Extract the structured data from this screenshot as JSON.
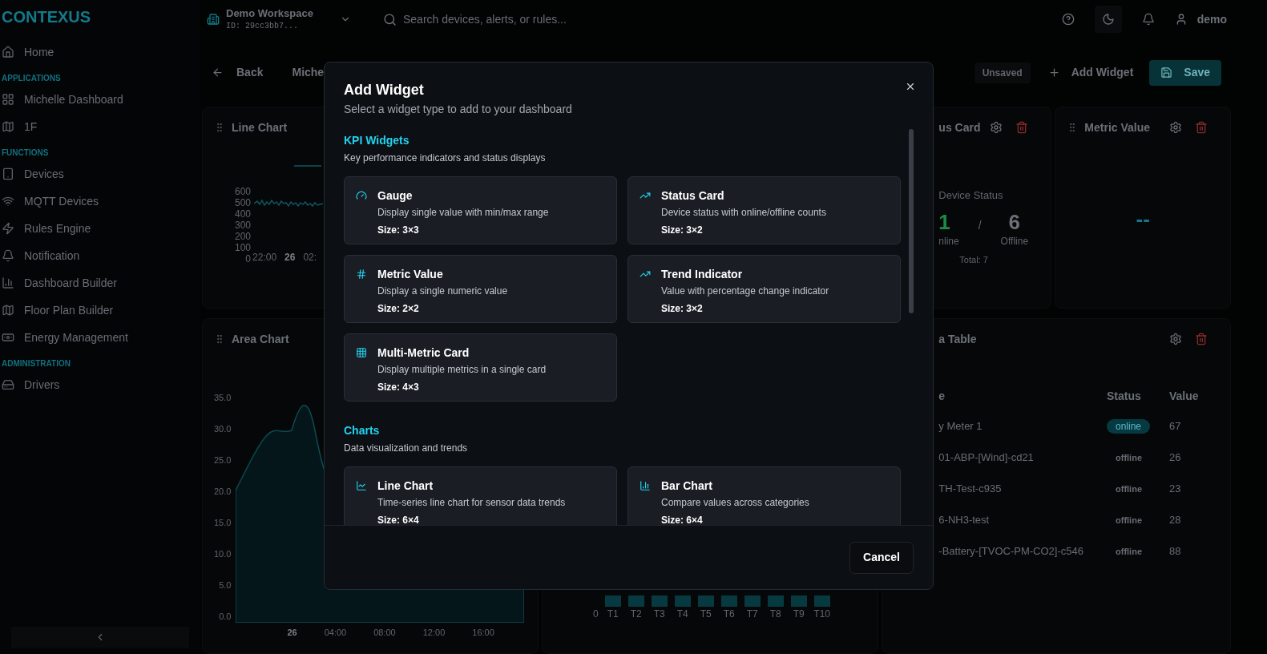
{
  "sidebar": {
    "logo": "CONTEXUS",
    "sections": [
      {
        "items": [
          {
            "label": "Home"
          }
        ]
      },
      {
        "title": "APPLICATIONS",
        "items": [
          {
            "label": "Michelle Dashboard"
          },
          {
            "label": "1F"
          }
        ]
      },
      {
        "title": "FUNCTIONS",
        "items": [
          {
            "label": "Devices"
          },
          {
            "label": "MQTT Devices"
          },
          {
            "label": "Rules Engine"
          },
          {
            "label": "Notification"
          },
          {
            "label": "Dashboard Builder"
          },
          {
            "label": "Floor Plan Builder"
          },
          {
            "label": "Energy Management"
          }
        ]
      },
      {
        "title": "ADMINISTRATION",
        "items": [
          {
            "label": "Drivers"
          }
        ]
      }
    ]
  },
  "header": {
    "workspace": {
      "name": "Demo Workspace",
      "id": "ID: 29cc3bb7..."
    },
    "search": {
      "placeholder": "Search devices, alerts, or rules..."
    },
    "user": "demo"
  },
  "toolbar": {
    "back": "Back",
    "dashboard_name": "Miche",
    "status_badge": "Unsaved",
    "add_widget": "Add Widget",
    "save": "Save"
  },
  "widgets": {
    "line_chart": {
      "title": "Line Chart",
      "y_ticks": [
        "600",
        "500",
        "400",
        "300",
        "200",
        "100",
        "0"
      ],
      "x_ticks": [
        {
          "label": "22:00",
          "major": false
        },
        {
          "label": "26",
          "major": true
        },
        {
          "label": "02:",
          "major": false
        }
      ]
    },
    "area_chart": {
      "title": "Area Chart",
      "y_ticks": [
        "35.0",
        "30.0",
        "25.0",
        "20.0",
        "15.0",
        "10.0",
        "5.0",
        "0.0"
      ],
      "x_ticks": [
        {
          "label": "26",
          "major": true
        },
        {
          "label": "04:00",
          "major": false
        },
        {
          "label": "08:00",
          "major": false
        },
        {
          "label": "12:00",
          "major": false
        },
        {
          "label": "16:00",
          "major": false
        }
      ]
    },
    "bar_chart": {
      "y_tick": "0",
      "categories": [
        "T1",
        "T2",
        "T3",
        "T4",
        "T5",
        "T6",
        "T7",
        "T8",
        "T9",
        "T10"
      ]
    },
    "status_card": {
      "title": "us Card",
      "label": "Device Status",
      "online_count": "1",
      "separator": "/",
      "offline_count": "6",
      "online_label": "nline",
      "offline_label": "Offline",
      "total": "Total: 7"
    },
    "metric_value": {
      "title": "Metric Value",
      "value": "--"
    },
    "data_table": {
      "title": "a Table",
      "columns": [
        "e",
        "Status",
        "Value"
      ],
      "rows": [
        {
          "name": "y Meter 1",
          "status": "online",
          "kind": "online",
          "value": "67"
        },
        {
          "name": "01-ABP-[Wind]-cd21",
          "status": "offline",
          "kind": "offline",
          "value": "26"
        },
        {
          "name": "TH-Test-c935",
          "status": "offline",
          "kind": "offline",
          "value": "23"
        },
        {
          "name": "6-NH3-test",
          "status": "offline",
          "kind": "offline",
          "value": "28"
        },
        {
          "name": "-Battery-[TVOC-PM-CO2]-c546",
          "status": "offline",
          "kind": "offline",
          "value": "88"
        }
      ]
    }
  },
  "modal": {
    "title": "Add Widget",
    "subtitle": "Select a widget type to add to your dashboard",
    "sections": [
      {
        "title": "KPI Widgets",
        "description": "Key performance indicators and status displays",
        "widgets": [
          {
            "name": "Gauge",
            "description": "Display single value with min/max range",
            "size": "Size: 3×3"
          },
          {
            "name": "Status Card",
            "description": "Device status with online/offline counts",
            "size": "Size: 3×2"
          },
          {
            "name": "Metric Value",
            "description": "Display a single numeric value",
            "size": "Size: 2×2"
          },
          {
            "name": "Trend Indicator",
            "description": "Value with percentage change indicator",
            "size": "Size: 3×2"
          },
          {
            "name": "Multi-Metric Card",
            "description": "Display multiple metrics in a single card",
            "size": "Size: 4×3"
          }
        ]
      },
      {
        "title": "Charts",
        "description": "Data visualization and trends",
        "widgets": [
          {
            "name": "Line Chart",
            "description": "Time-series line chart for sensor data trends",
            "size": "Size: 6×4"
          },
          {
            "name": "Bar Chart",
            "description": "Compare values across categories",
            "size": "Size: 6×4"
          }
        ]
      }
    ],
    "cancel": "Cancel"
  }
}
